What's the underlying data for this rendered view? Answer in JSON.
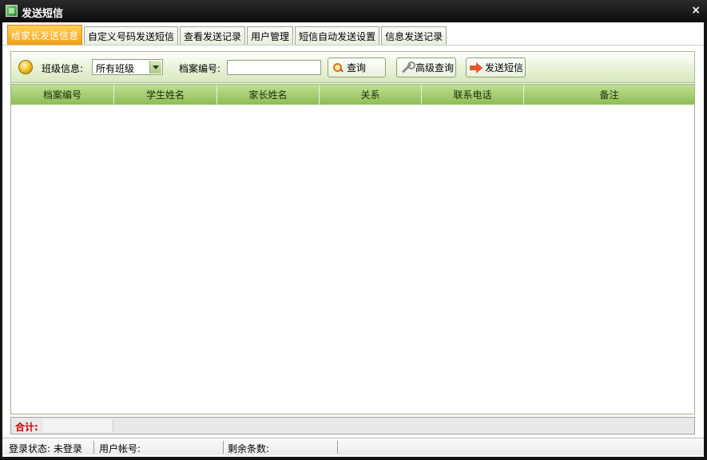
{
  "window": {
    "title": "发送短信",
    "close_label": "×"
  },
  "tabs": [
    {
      "label": "给家长发送信息",
      "active": true
    },
    {
      "label": "自定义号码发送短信",
      "active": false
    },
    {
      "label": "查看发送记录",
      "active": false
    },
    {
      "label": "用户管理",
      "active": false
    },
    {
      "label": "短信自动发送设置",
      "active": false
    },
    {
      "label": "信息发送记录",
      "active": false
    }
  ],
  "toolbar": {
    "class_label": "班级信息:",
    "class_selected": "所有班级",
    "file_no_label": "档案编号:",
    "file_no_value": "",
    "query_button": "查询",
    "advanced_button": "高级查询",
    "send_button": "发送短信"
  },
  "table": {
    "columns": [
      "档案编号",
      "学生姓名",
      "家长姓名",
      "关系",
      "联系电话",
      "备注"
    ],
    "rows": []
  },
  "summary": {
    "total_label": "合计:"
  },
  "status": {
    "login_state": "登录状态: 未登录",
    "account": "用户帐号:",
    "remaining": "剩余条数:"
  },
  "colors": {
    "accent_tab": "#f39a12",
    "header_green": "#8dbd56",
    "total_red": "#cc0000"
  }
}
